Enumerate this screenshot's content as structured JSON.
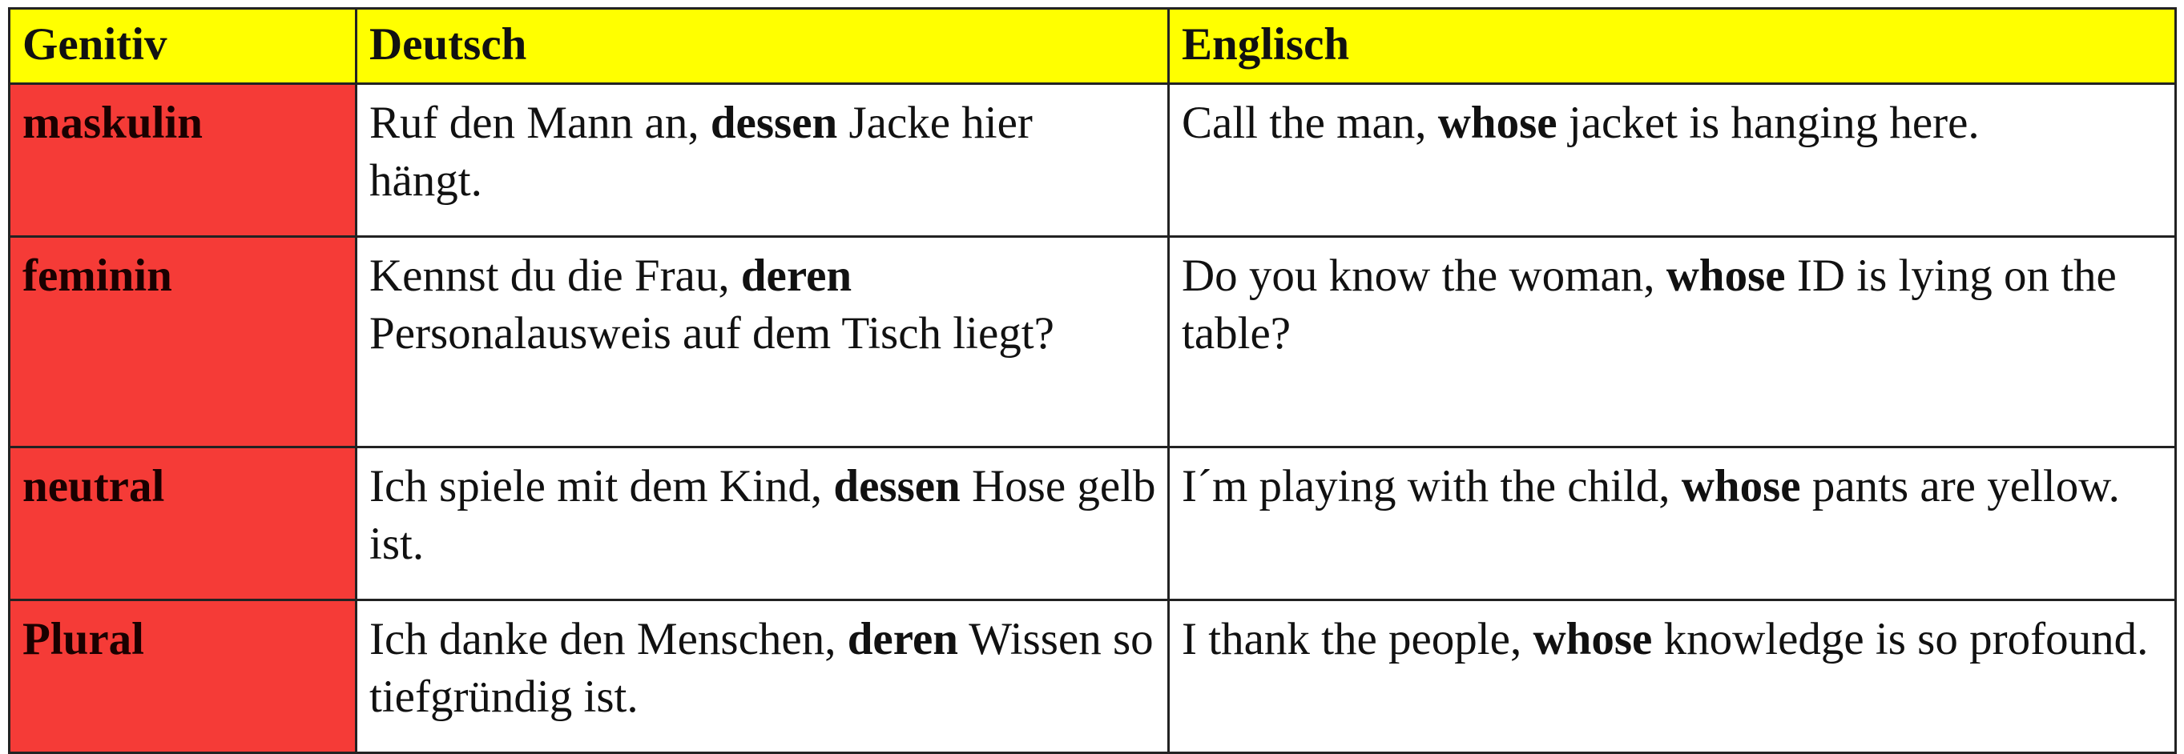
{
  "table": {
    "headers": [
      "Genitiv",
      "Deutsch",
      "Englisch"
    ],
    "rows": [
      {
        "case": "maskulin",
        "de": {
          "pre": "Ruf den Mann an, ",
          "bold": "dessen",
          "post": " Jacke hier hängt."
        },
        "en": {
          "pre": "Call the man, ",
          "bold": "whose",
          "post": " jacket is hanging here."
        }
      },
      {
        "case": "feminin",
        "de": {
          "pre": "Kennst du die Frau, ",
          "bold": "deren",
          "post": " Personalausweis auf dem Tisch liegt?"
        },
        "en": {
          "pre": "Do you know the woman, ",
          "bold": "whose",
          "post": " ID is lying on the table?"
        }
      },
      {
        "case": "neutral",
        "de": {
          "pre": "Ich spiele mit dem Kind, ",
          "bold": "dessen",
          "post": " Hose gelb ist."
        },
        "en": {
          "pre": "I´m playing with the child, ",
          "bold": "whose",
          "post": " pants are yellow."
        }
      },
      {
        "case": "Plural",
        "de": {
          "pre": "Ich danke den Menschen, ",
          "bold": "deren",
          "post": " Wissen so tiefgründig ist."
        },
        "en": {
          "pre": "I thank the people, ",
          "bold": "whose",
          "post": " knowledge is so profound."
        }
      }
    ]
  },
  "colors": {
    "header_bg": "#ffff00",
    "case_bg": "#f53b37",
    "cell_bg": "#ffffff",
    "border": "#222222"
  }
}
